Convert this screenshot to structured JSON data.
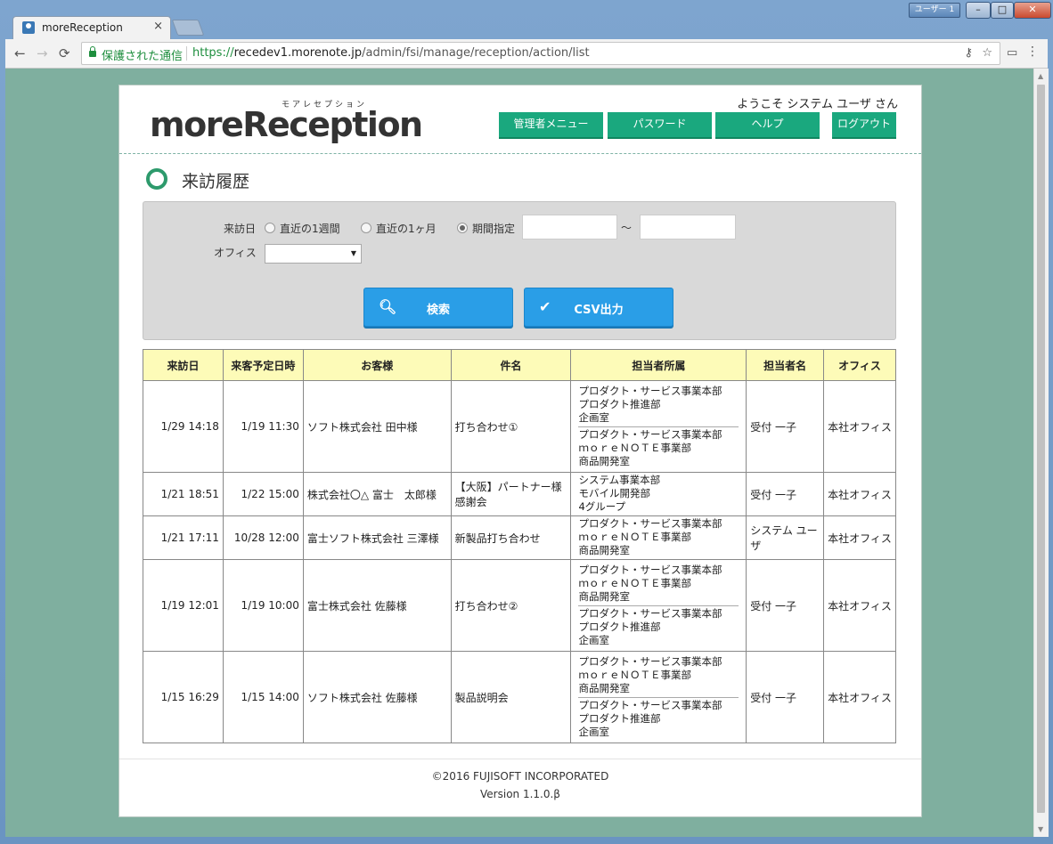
{
  "browser": {
    "tab_title": "moreReception",
    "tab_close": "×",
    "user_button": "ユーザー 1",
    "win_min": "–",
    "win_max": "□",
    "win_close": "✕",
    "security_label": "保護された通信",
    "url_scheme": "https://",
    "url_host": "recedev1.morenote.jp",
    "url_path": "/admin/fsi/manage/reception/action/list"
  },
  "header": {
    "logo_kana": "モアレセプション",
    "logo_text": "moreReception",
    "welcome": "ようこそ システム ユーザ さん",
    "nav": [
      "管理者メニュー",
      "パスワード",
      "ヘルプ",
      "ログアウト"
    ]
  },
  "page_title": "来訪履歴",
  "search": {
    "visit_date_label": "来訪日",
    "radio_week": "直近の1週間",
    "radio_month": "直近の1ヶ月",
    "radio_period": "期間指定",
    "selected": "期間指定",
    "from_value": "",
    "tilde": "～",
    "to_value": "",
    "office_label": "オフィス",
    "office_value": "",
    "search_button": "検索",
    "csv_button": "CSV出力"
  },
  "table": {
    "headers": [
      "来訪日",
      "来客予定日時",
      "お客様",
      "件名",
      "担当者所属",
      "担当者名",
      "オフィス"
    ],
    "rows": [
      {
        "visit": "1/29 14:18",
        "sched": "1/19 11:30",
        "customer": "ソフト株式会社 田中様",
        "subject": "打ち合わせ①",
        "depts": [
          [
            "プロダクト・サービス事業本部",
            "プロダクト推進部",
            "企画室"
          ],
          [
            "プロダクト・サービス事業本部",
            "ｍｏｒｅＮＯＴＥ事業部",
            "商品開発室"
          ]
        ],
        "person": "受付 一子",
        "office": "本社オフィス"
      },
      {
        "visit": "1/21 18:51",
        "sched": "1/22 15:00",
        "customer": "株式会社〇△ 富士　太郎様",
        "subject": "【大阪】パートナー様感謝会",
        "depts": [
          [
            "システム事業本部",
            "モバイル開発部",
            "4グループ"
          ]
        ],
        "person": "受付 一子",
        "office": "本社オフィス"
      },
      {
        "visit": "1/21 17:11",
        "sched": "10/28 12:00",
        "customer": "富士ソフト株式会社 三澤様",
        "subject": "新製品打ち合わせ",
        "depts": [
          [
            "プロダクト・サービス事業本部",
            "ｍｏｒｅＮＯＴＥ事業部",
            "商品開発室"
          ]
        ],
        "person": "システム ユーザ",
        "office": "本社オフィス"
      },
      {
        "visit": "1/19 12:01",
        "sched": "1/19 10:00",
        "customer": "富士株式会社 佐藤様",
        "subject": "打ち合わせ②",
        "depts": [
          [
            "プロダクト・サービス事業本部",
            "ｍｏｒｅＮＯＴＥ事業部",
            "商品開発室"
          ],
          [
            "プロダクト・サービス事業本部",
            "プロダクト推進部",
            "企画室"
          ]
        ],
        "person": "受付 一子",
        "office": "本社オフィス"
      },
      {
        "visit": "1/15 16:29",
        "sched": "1/15 14:00",
        "customer": "ソフト株式会社 佐藤様",
        "subject": "製品説明会",
        "depts": [
          [
            "プロダクト・サービス事業本部",
            "ｍｏｒｅＮＯＴＥ事業部",
            "商品開発室"
          ],
          [
            "プロダクト・サービス事業本部",
            "プロダクト推進部",
            "企画室"
          ]
        ],
        "person": "受付 一子",
        "office": "本社オフィス"
      }
    ]
  },
  "footer": {
    "copyright": "©2016 FUJISOFT INCORPORATED",
    "version": "Version 1.1.0.β"
  }
}
